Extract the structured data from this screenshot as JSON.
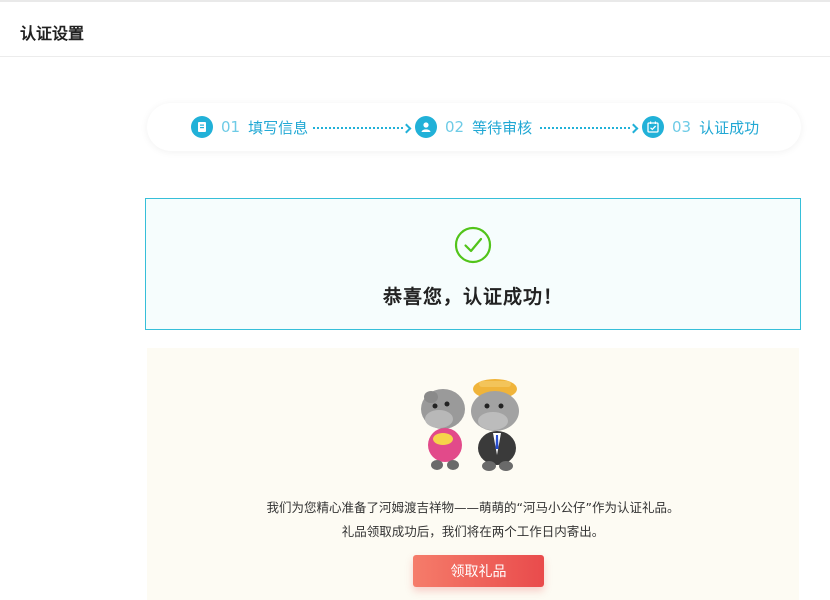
{
  "header": {
    "title": "认证设置"
  },
  "steps": [
    {
      "num": "01",
      "label": "填写信息",
      "icon": "document-icon"
    },
    {
      "num": "02",
      "label": "等待审核",
      "icon": "user-check-icon"
    },
    {
      "num": "03",
      "label": "认证成功",
      "icon": "calendar-check-icon"
    }
  ],
  "success": {
    "message": "恭喜您，认证成功！"
  },
  "gift": {
    "line1": "我们为您精心准备了河姆渡吉祥物——萌萌的“河马小公仔”作为认证礼品。",
    "line2": "礼品领取成功后，我们将在两个工作日内寄出。",
    "button": "领取礼品"
  },
  "colors": {
    "accent": "#21b1d8",
    "success": "#52c41a",
    "button": "#e94b4c"
  }
}
